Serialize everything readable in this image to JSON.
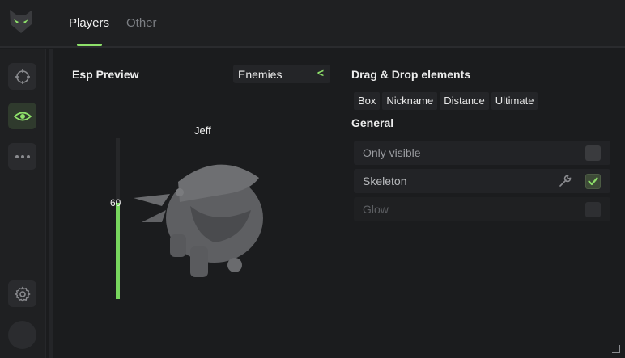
{
  "header": {
    "tabs": [
      {
        "label": "Players",
        "active": true
      },
      {
        "label": "Other",
        "active": false
      }
    ]
  },
  "sidebar": {
    "items": [
      {
        "icon": "crosshair-icon"
      },
      {
        "icon": "eye-icon",
        "active": true
      },
      {
        "icon": "more-icon"
      }
    ],
    "settings_icon": "gear-icon"
  },
  "preview": {
    "title": "Esp Preview",
    "target_select": "Enemies",
    "player_name": "Jeff",
    "health_value": "60",
    "health_fraction": 0.6
  },
  "dragdrop": {
    "title": "Drag & Drop elements",
    "elements": [
      "Box",
      "Nickname",
      "Distance",
      "Ultimate"
    ]
  },
  "general": {
    "title": "General",
    "options": [
      {
        "label": "Only visible",
        "checked": false,
        "enabled": true
      },
      {
        "label": "Skeleton",
        "checked": true,
        "enabled": true,
        "has_settings": true
      },
      {
        "label": "Glow",
        "checked": false,
        "enabled": false
      }
    ]
  },
  "colors": {
    "accent": "#8ee06a",
    "background": "#1b1c1e",
    "panel": "#222326"
  }
}
